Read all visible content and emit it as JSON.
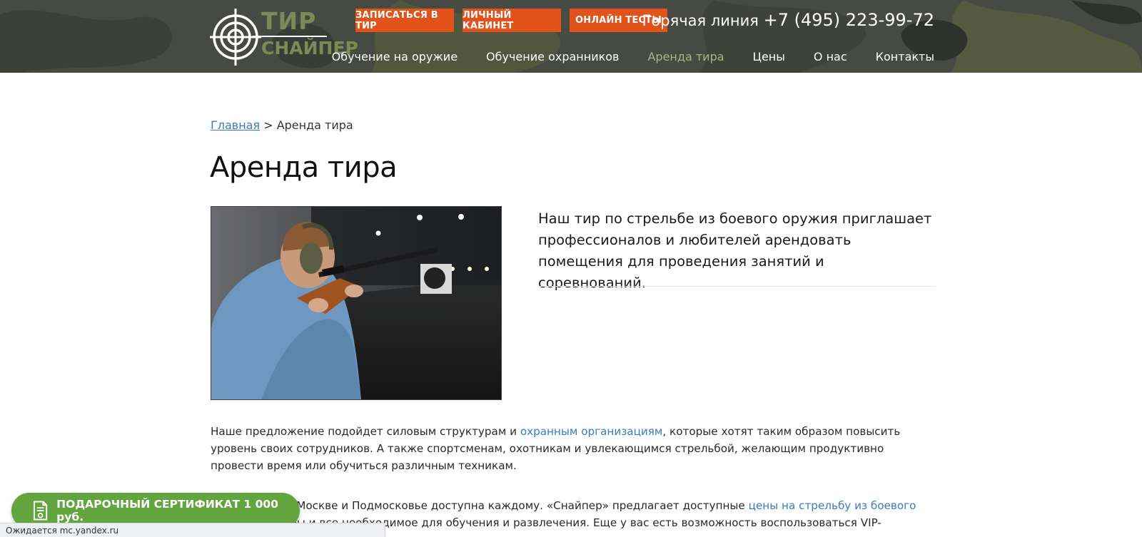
{
  "header": {
    "logo": {
      "line1": "ТИР",
      "line2": "СНАЙПЕР"
    },
    "buttons": [
      "ЗАПИСАТЬСЯ В ТИР",
      "ЛИЧНЫЙ КАБИНЕТ",
      "ОНЛАЙН ТЕСТЫ"
    ],
    "hotline_label": "Горячая линия",
    "hotline_phone": "+7 (495) 223-99-72",
    "nav": [
      "Обучение на оружие",
      "Обучение охранников",
      "Аренда тира",
      "Цены",
      "О нас",
      "Контакты"
    ],
    "active_nav": "Аренда тира",
    "accent_color": "#e0531b",
    "active_nav_color": "#a8b58a"
  },
  "breadcrumb": {
    "home": "Главная",
    "separator": " > ",
    "current": "Аренда тира"
  },
  "page_title": "Аренда тира",
  "lead": "Наш тир по стрельбе из боевого оружия приглашает профессионалов и любителей арендовать помещения для проведения занятий и соревнований.",
  "paragraph1": {
    "before": "Наше предложение подойдет силовым структурам и ",
    "link": "охранным организациям",
    "after": ", которые хотят таким образом повысить уровень своих сотрудников. А также спортсменам, охотникам и увлекающимся стрельбой, желающим продуктивно провести время или обучиться различным техникам."
  },
  "paragraph2": {
    "before": "Аренда тира в Москве и Подмосковье доступна каждому. «Снайпер» предлагает доступные ",
    "link": "цены на стрельбу из боевого оружия",
    "after": ", тарифы и все необходимое для обучения и развлечения. Еще у вас есть возможность воспользоваться VIP-"
  },
  "gift_button": "ПОДАРОЧНЫЙ СЕРТИФИКАТ 1 000 руб.",
  "status_bar": "Ожидается mc.yandex.ru",
  "icons": [
    "crosshair-logo-icon",
    "certificate-icon"
  ]
}
